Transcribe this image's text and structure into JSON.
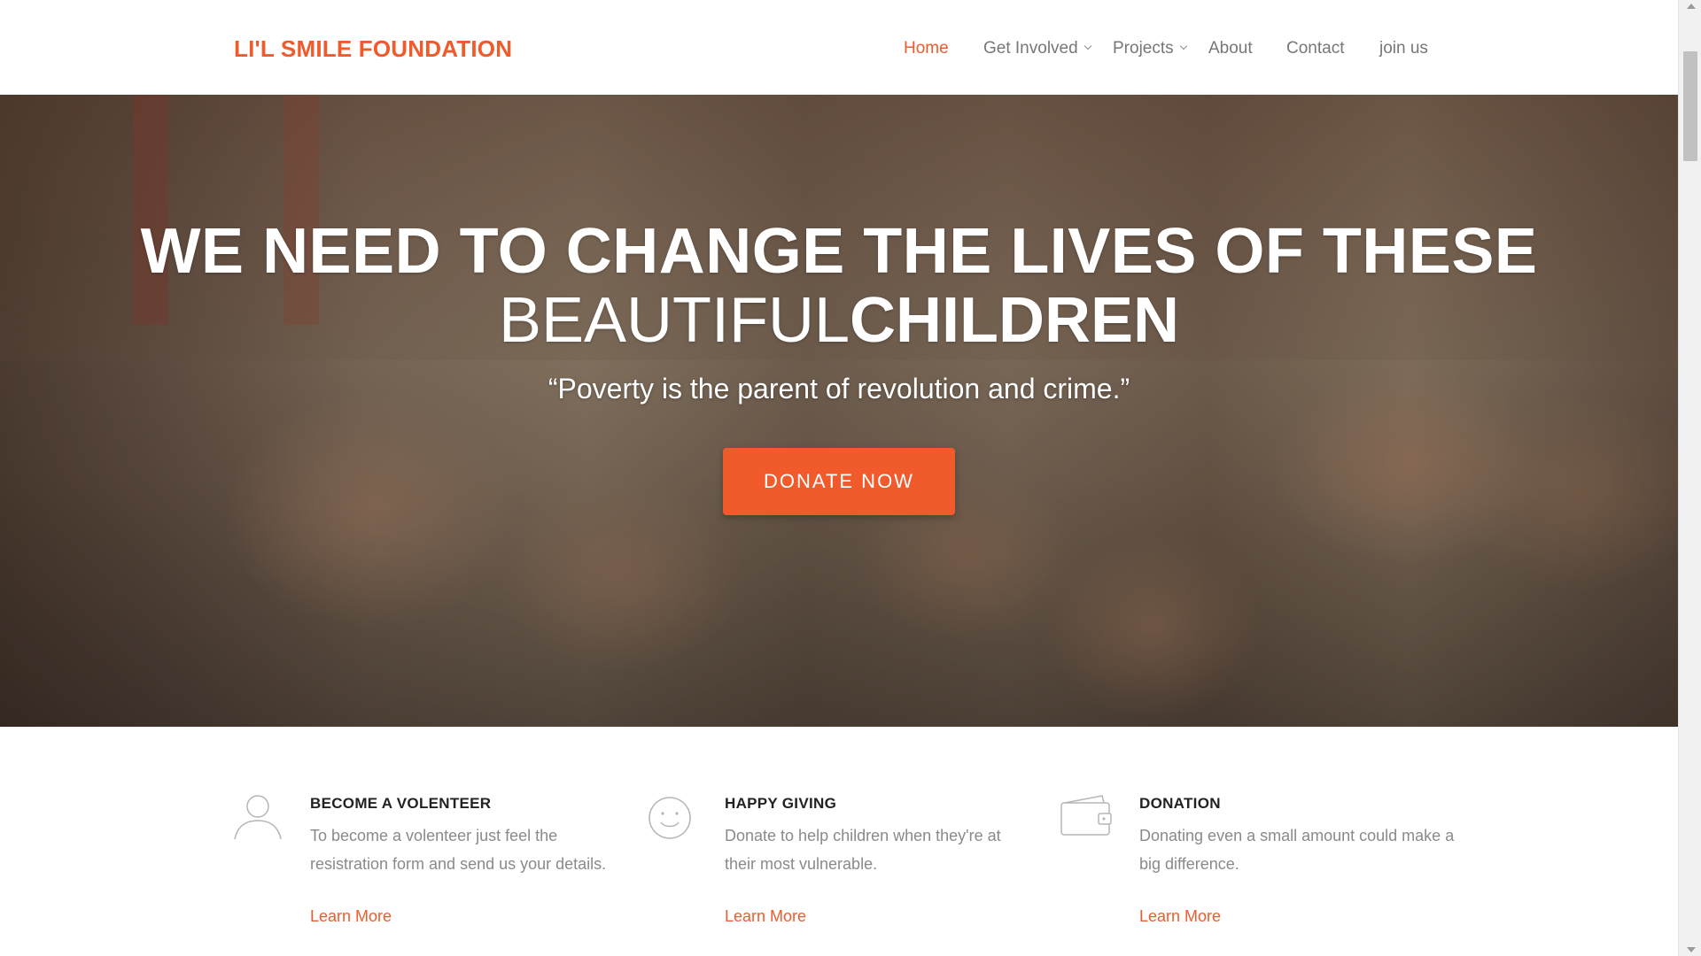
{
  "brand": {
    "name": "LI'L SMILE FOUNDATION",
    "accent_color": "#f15a2b"
  },
  "nav": {
    "items": [
      {
        "label": "Home",
        "active": true,
        "dropdown": false
      },
      {
        "label": "Get Involved",
        "active": false,
        "dropdown": true
      },
      {
        "label": "Projects",
        "active": false,
        "dropdown": true
      },
      {
        "label": "About",
        "active": false,
        "dropdown": false
      },
      {
        "label": "Contact",
        "active": false,
        "dropdown": false
      },
      {
        "label": "join us",
        "active": false,
        "dropdown": false
      }
    ]
  },
  "hero": {
    "title_line1": "WE NEED TO CHANGE THE LIVES OF THESE",
    "title_line2_light": "BEAUTIFUL",
    "title_line2_bold": "CHILDREN",
    "quote": "“Poverty is the parent of revolution and crime.”",
    "cta_label": "DONATE NOW"
  },
  "features": [
    {
      "icon": "user-outline-icon",
      "title": "BECOME A VOLENTEER",
      "text": "To become a volenteer just feel the resistration form and send us your details.",
      "link": "Learn More"
    },
    {
      "icon": "smiley-icon",
      "title": "HAPPY GIVING",
      "text": "Donate to help children when they're at their most vulnerable.",
      "link": "Learn More"
    },
    {
      "icon": "wallet-icon",
      "title": "DONATION",
      "text": "Donating even a small amount could make a big difference.",
      "link": "Learn More"
    }
  ]
}
